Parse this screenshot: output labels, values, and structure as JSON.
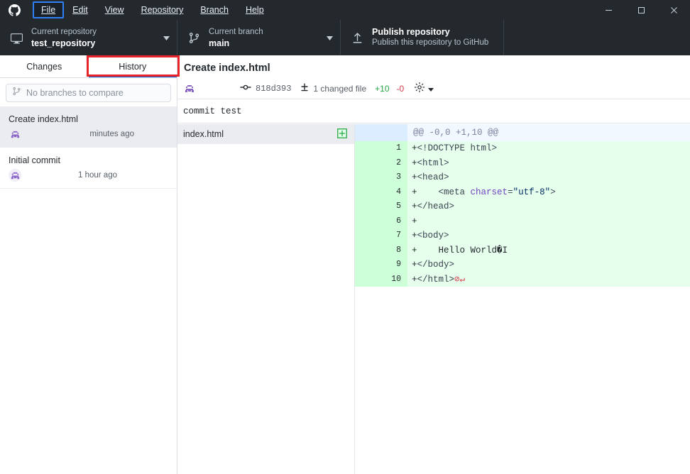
{
  "window": {
    "app_icon": "github-logo-icon",
    "controls": {
      "minimize": "minimize-icon",
      "maximize": "maximize-icon",
      "close": "close-icon"
    }
  },
  "menu": {
    "items": [
      {
        "label": "File",
        "accesskey": "F",
        "focused": true
      },
      {
        "label": "Edit",
        "accesskey": "E",
        "focused": false
      },
      {
        "label": "View",
        "accesskey": "V",
        "focused": false
      },
      {
        "label": "Repository",
        "accesskey": "R",
        "focused": false
      },
      {
        "label": "Branch",
        "accesskey": "B",
        "focused": false
      },
      {
        "label": "Help",
        "accesskey": "H",
        "focused": false
      }
    ]
  },
  "toolbar": {
    "repository": {
      "label": "Current repository",
      "value": "test_repository",
      "icon": "repo-desktop-icon",
      "caret": "chevron-down-icon"
    },
    "branch": {
      "label": "Current branch",
      "value": "main",
      "icon": "git-branch-icon",
      "caret": "chevron-down-icon"
    },
    "publish": {
      "title": "Publish repository",
      "subtitle": "Publish this repository to GitHub",
      "icon": "upload-icon"
    }
  },
  "sidebar": {
    "tabs": [
      {
        "label": "Changes",
        "active": false
      },
      {
        "label": "History",
        "active": true
      }
    ],
    "filter": {
      "placeholder": "No branches to compare",
      "icon": "git-branch-icon"
    },
    "commits": [
      {
        "title": "Create index.html",
        "author": "",
        "time": "minutes ago",
        "avatar": "user-avatar",
        "selected": true
      },
      {
        "title": "Initial commit",
        "author": "",
        "time": "1 hour ago",
        "avatar": "user-avatar",
        "selected": false
      }
    ]
  },
  "commit": {
    "title": "Create index.html",
    "avatar": "user-avatar",
    "sha": "818d393",
    "sha_icon": "git-commit-icon",
    "changed_files": "1 changed file",
    "changed_icon": "diff-added-icon",
    "additions": "+10",
    "deletions": "-0",
    "gear_icon": "gear-icon",
    "gear_caret": "chevron-down-icon",
    "description": "commit test"
  },
  "files": [
    {
      "name": "index.html",
      "status_icon": "diff-added-plus-icon"
    }
  ],
  "diff": {
    "hunk_header": "@@ -0,0 +1,10 @@",
    "lines": [
      {
        "num": "1",
        "marker": "+",
        "text": "<!DOCTYPE html>"
      },
      {
        "num": "2",
        "marker": "+",
        "text": "<html>"
      },
      {
        "num": "3",
        "marker": "+",
        "text": "<head>"
      },
      {
        "num": "4",
        "marker": "+",
        "text": "    <meta charset=\"utf-8\">"
      },
      {
        "num": "5",
        "marker": "+",
        "text": "</head>"
      },
      {
        "num": "6",
        "marker": "+",
        "text": ""
      },
      {
        "num": "7",
        "marker": "+",
        "text": "<body>"
      },
      {
        "num": "8",
        "marker": "+",
        "text": "    Hello World�I"
      },
      {
        "num": "9",
        "marker": "+",
        "text": "</body>"
      },
      {
        "num": "10",
        "marker": "+",
        "text": "</html>",
        "eol_markers": "⊘↵"
      }
    ]
  },
  "colors": {
    "chrome_bg": "#24292e",
    "accent_blue": "#0366d6",
    "addition_bg": "#e6ffed",
    "addition_gutter": "#cdffd8",
    "hunk_bg": "#f1f8ff",
    "hunk_gutter": "#dbedff",
    "additions_text": "#28a745",
    "deletions_text": "#d73a49",
    "annotation_red": "#e8242a"
  }
}
